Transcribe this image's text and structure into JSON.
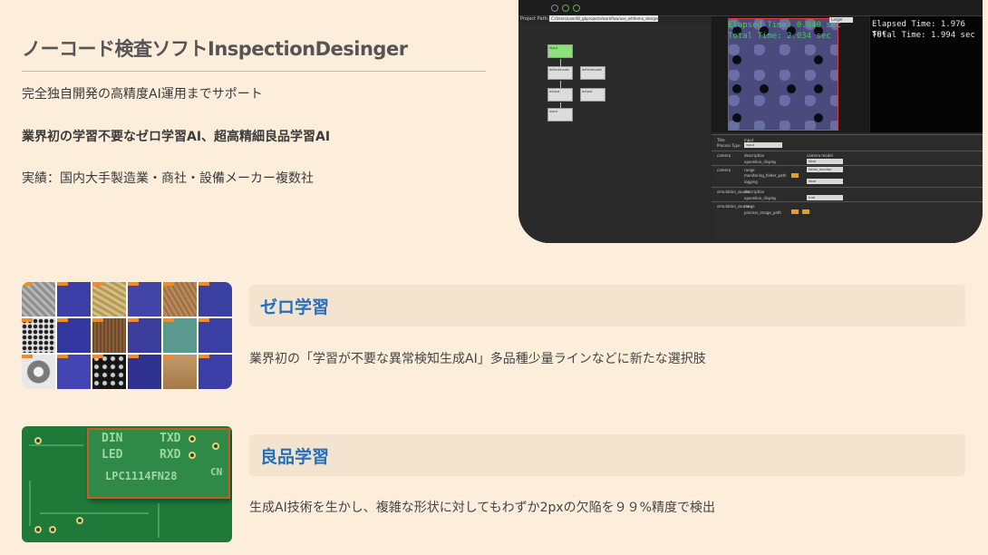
{
  "header": {
    "title": "ノーコード検査ソフトInspectionDesinger",
    "lines": [
      "完全独自開発の高精度AI運用までサポート",
      "業界初の学習不要なゼロ学習AI、超高精細良品学習AI",
      "実績：国内大手製造業・商社・設備メーカー複数社"
    ]
  },
  "app_screenshot": {
    "path_label": "Project Path:",
    "path_value": "C:/Users/user/IB_gbprojects/workflow/use_wf/demo_designer/",
    "select_label": "Larger",
    "elapsed_a": "Elapsed Time: 0.040 sec",
    "total_a": "Total Time: 2.034 sec",
    "elapsed_b": "Elapsed Time: 1.976 sec",
    "total_b": "Total Time: 1.994 sec",
    "nodes": [
      "input",
      "defectmodel",
      "defectmodel",
      "output",
      "output",
      "input"
    ],
    "props": {
      "title_label": "Title",
      "title_value": "input",
      "type_label": "Process Type",
      "type_value": "input",
      "camera_label": "camera",
      "description": "description",
      "operation_display": "operation_display",
      "camera_model": "camera model",
      "range": "range",
      "mode": "folder_monitor",
      "monitoring_folder_path": "monitoring_folder_path",
      "logging": "logging",
      "false_value": "false",
      "true_value": "true",
      "simulation_source": "simulation_source",
      "process_image_path": "process_image_path"
    }
  },
  "sections": [
    {
      "heading": "ゼロ学習",
      "description": "業界初の「学習が不要な異常検知生成AI」多品種少量ラインなどに新たな選択肢"
    },
    {
      "heading": "良品学習",
      "description": "生成AI技術を生かし、複雑な形状に対してもわずか2pxの欠陥を９９%精度で検出"
    }
  ],
  "pcb_labels": [
    "DIN",
    "LED",
    "TXD",
    "RXD",
    "LPC1114FN28",
    "CN"
  ],
  "colors": {
    "background": "#fdeedb",
    "accent_heading": "#2470bd",
    "section_bar": "#f4e3cf",
    "elapsed_green": "#36d936"
  }
}
